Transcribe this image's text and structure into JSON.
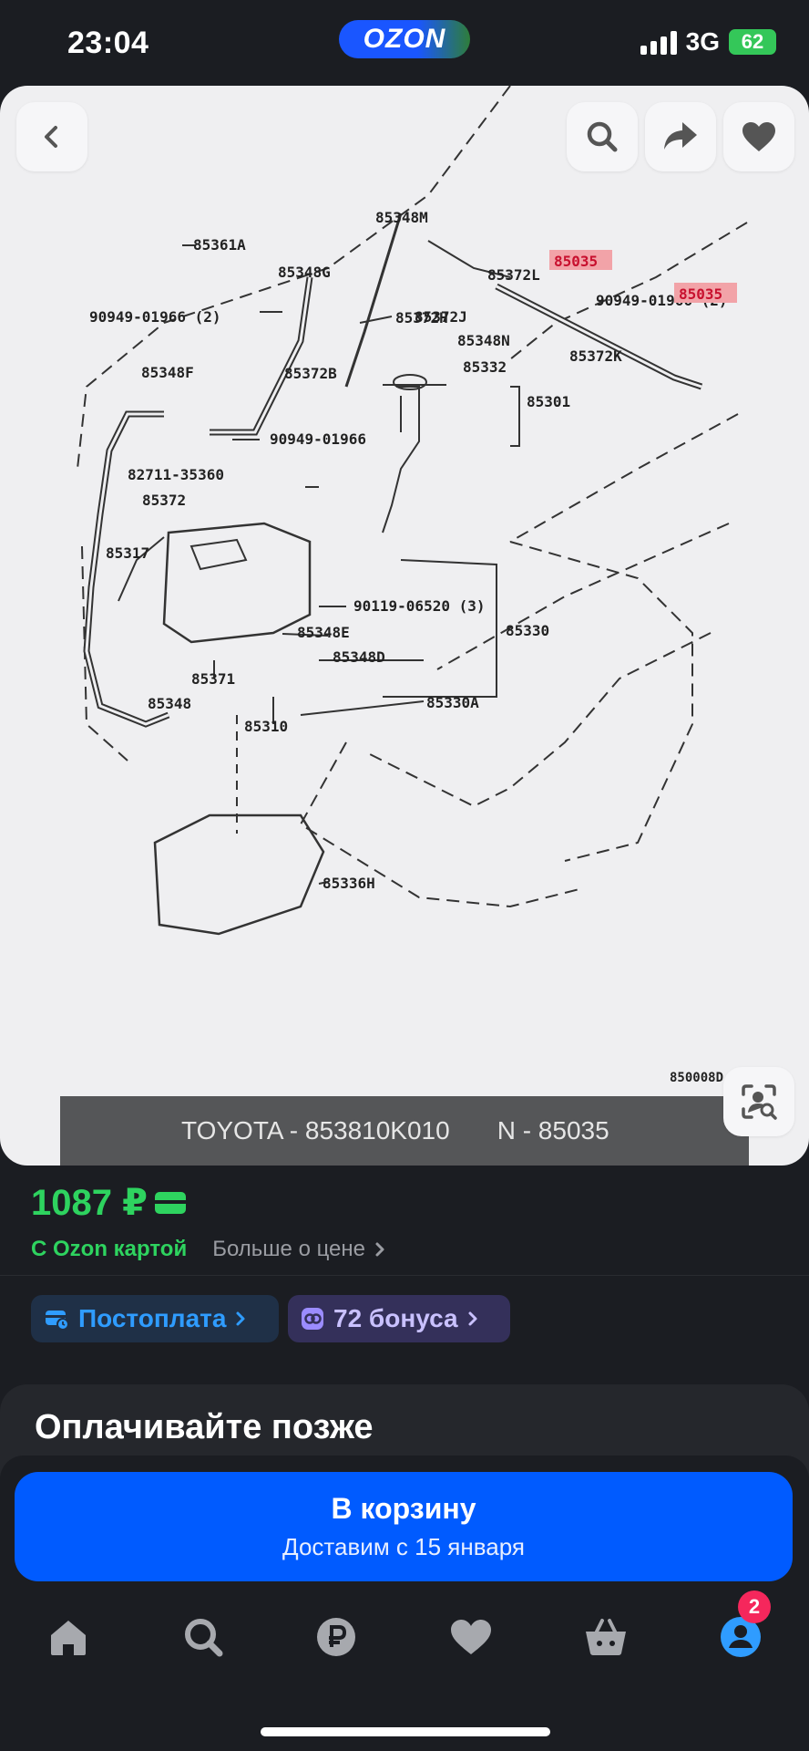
{
  "status_bar": {
    "time": "23:04",
    "logo": "OZON",
    "network": "3G",
    "battery": "62"
  },
  "product_image": {
    "back_icon": "chevron-left-icon",
    "search_icon": "search-icon",
    "share_icon": "share-arrow-icon",
    "favorite_icon": "heart-icon",
    "visual_search_icon": "visual-search-icon",
    "diagram_labels": [
      "85348M",
      "85361A",
      "85348G",
      "85372L",
      "85035",
      "90949-01966 (2)",
      "85372J",
      "85348N",
      "85035",
      "90949-01966 (2)",
      "85372H",
      "85372K",
      "85348F",
      "85372B",
      "85332",
      "85301",
      "90949-01966",
      "82711-35360",
      "85372",
      "85317",
      "90119-06520 (3)",
      "85330",
      "85348E",
      "85348D",
      "85371",
      "85348",
      "85330A",
      "85310",
      "85336H",
      "850008D"
    ],
    "caption_left": "TOYOTA - 853810K010",
    "caption_right": "N - 85035"
  },
  "price": {
    "amount": "1087 ₽",
    "with_card": "С Ozon картой",
    "more_about_price": "Больше о цене"
  },
  "chips": [
    {
      "label": "Постоплата"
    },
    {
      "label": "72 бонуса"
    }
  ],
  "section": {
    "title": "Оплачивайте позже"
  },
  "cart": {
    "title": "В корзину",
    "subtitle": "Доставим с 15 января"
  },
  "tabbar": {
    "profile_badge": "2"
  },
  "colors": {
    "accent_blue": "#005bff",
    "price_green": "#2ed35f",
    "badge_pink": "#f5275c"
  }
}
